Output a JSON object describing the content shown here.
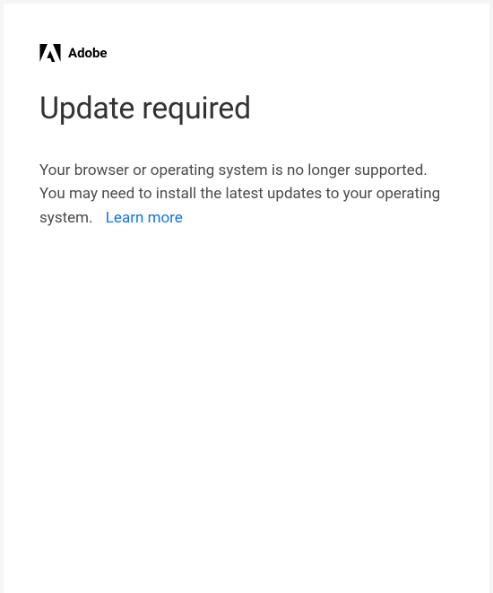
{
  "brand": {
    "name": "Adobe"
  },
  "heading": "Update required",
  "message": "Your browser or operating system is no longer supported. You may need to install the latest updates to your operating system.",
  "learn_more_label": "Learn more"
}
